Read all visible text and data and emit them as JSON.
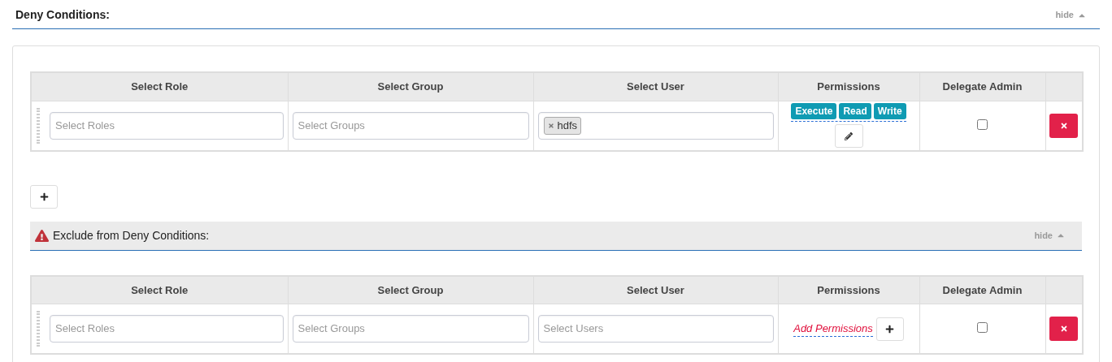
{
  "section": {
    "title": "Deny Conditions:",
    "toggle": "hide",
    "expanded": true
  },
  "deny_table": {
    "columns": [
      "Select Role",
      "Select Group",
      "Select User",
      "Permissions",
      "Delegate Admin"
    ],
    "rows": [
      {
        "roles": {
          "placeholder": "Select Roles"
        },
        "groups": {
          "placeholder": "Select Groups"
        },
        "users": {
          "tags": [
            "hdfs"
          ]
        },
        "permissions": [
          "Execute",
          "Read",
          "Write"
        ],
        "delegate_admin": false
      }
    ]
  },
  "exclude_section": {
    "title": "Exclude from Deny Conditions:",
    "toggle": "hide",
    "expanded": true
  },
  "exclude_table": {
    "columns": [
      "Select Role",
      "Select Group",
      "Select User",
      "Permissions",
      "Delegate Admin"
    ],
    "rows": [
      {
        "roles": {
          "placeholder": "Select Roles"
        },
        "groups": {
          "placeholder": "Select Groups"
        },
        "users": {
          "placeholder": "Select Users"
        },
        "add_permissions": "Add Permissions",
        "delegate_admin": false
      }
    ]
  }
}
